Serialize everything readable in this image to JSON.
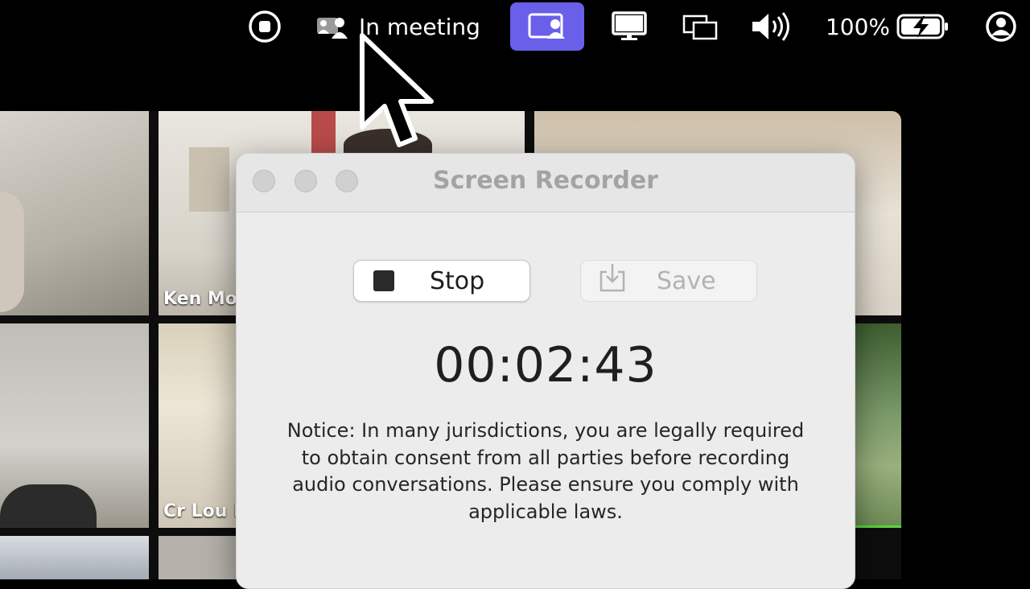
{
  "menubar": {
    "meeting_status": "In meeting",
    "battery_percent": "100%",
    "icons": [
      "stop-record-icon",
      "meeting-people-icon",
      "screen-share-icon",
      "display-icon",
      "mirror-display-icon",
      "volume-icon",
      "battery-charging-icon",
      "user-account-icon"
    ],
    "accent_color": "#6a5fe8"
  },
  "participants": [
    {
      "name": "Ken Mor"
    },
    {
      "name": "Cr Lou B"
    }
  ],
  "dialog": {
    "title": "Screen Recorder",
    "stop_label": "Stop",
    "save_label": "Save",
    "timer": "00:02:43",
    "notice": "Notice: In many jurisdictions, you are legally required to obtain consent from all parties before recording audio conversations. Please ensure you comply with applicable laws."
  }
}
